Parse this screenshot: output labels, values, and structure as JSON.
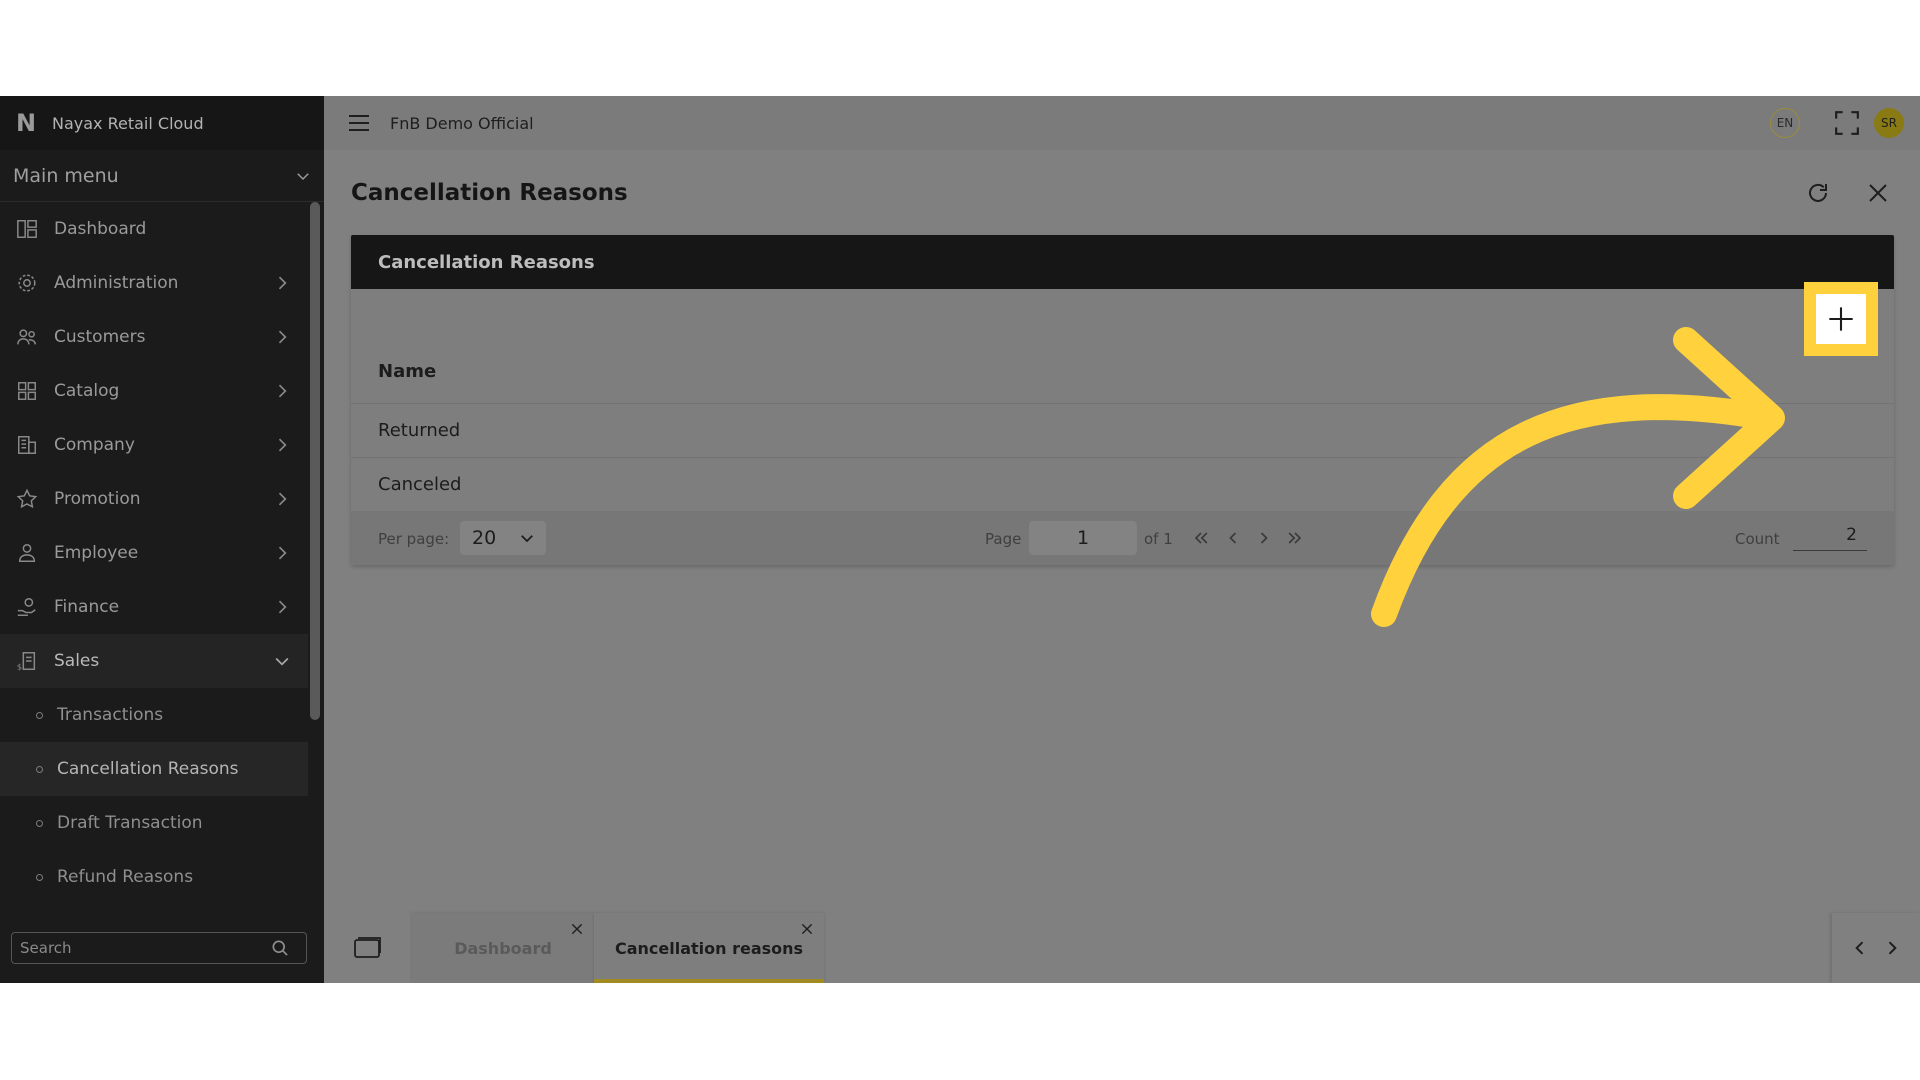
{
  "app": {
    "brand": "Nayax Retail Cloud",
    "org_name": "FnB Demo Official",
    "lang": "EN",
    "avatar": "SR"
  },
  "sidebar": {
    "main_menu": "Main menu",
    "items": [
      {
        "label": "Dashboard",
        "icon": "dashboard-icon"
      },
      {
        "label": "Administration",
        "icon": "admin-gear-icon"
      },
      {
        "label": "Customers",
        "icon": "customers-icon"
      },
      {
        "label": "Catalog",
        "icon": "catalog-grid-icon"
      },
      {
        "label": "Company",
        "icon": "company-building-icon"
      },
      {
        "label": "Promotion",
        "icon": "star-icon"
      },
      {
        "label": "Employee",
        "icon": "employee-icon"
      },
      {
        "label": "Finance",
        "icon": "finance-hand-icon"
      },
      {
        "label": "Sales",
        "icon": "sales-receipt-icon"
      }
    ],
    "sales_sub": [
      {
        "label": "Transactions"
      },
      {
        "label": "Cancellation Reasons"
      },
      {
        "label": "Draft Transaction"
      },
      {
        "label": "Refund Reasons"
      }
    ],
    "search_placeholder": "Search"
  },
  "page": {
    "title": "Cancellation Reasons"
  },
  "panel": {
    "title": "Cancellation Reasons",
    "column_name": "Name",
    "rows": [
      {
        "name": "Returned"
      },
      {
        "name": "Canceled"
      }
    ],
    "pager": {
      "per_page_label": "Per page:",
      "per_page_value": "20",
      "page_label": "Page",
      "page_value": "1",
      "of_label": "of 1",
      "count_label": "Count",
      "count_value": "2"
    }
  },
  "annotation": {
    "highlight_color": "#ffd23d"
  },
  "tabs": [
    {
      "label": "Dashboard",
      "active": false
    },
    {
      "label": "Cancellation reasons",
      "active": true
    }
  ]
}
